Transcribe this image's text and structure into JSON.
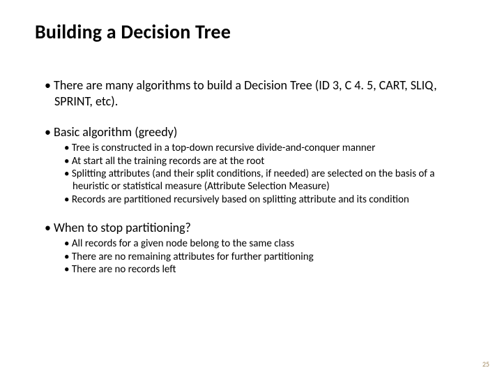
{
  "title": "Building a Decision Tree",
  "bullets": {
    "intro": "There are many algorithms to build a Decision Tree (ID 3, C 4. 5, CART, SLIQ, SPRINT, etc).",
    "basic": "Basic algorithm (greedy)",
    "basic_items": [
      "Tree is constructed in a top-down recursive divide-and-conquer manner",
      "At start all the training records are at the root",
      "Splitting attributes (and their split conditions, if needed) are selected on the basis of a heuristic or statistical measure (Attribute Selection Measure)",
      "Records are partitioned recursively based on splitting attribute and its condition"
    ],
    "stop": "When to stop partitioning?",
    "stop_items": [
      "All records for a given node belong to the same class",
      "There are no remaining attributes for further partitioning",
      "There are no records left"
    ]
  },
  "page_number": "25"
}
